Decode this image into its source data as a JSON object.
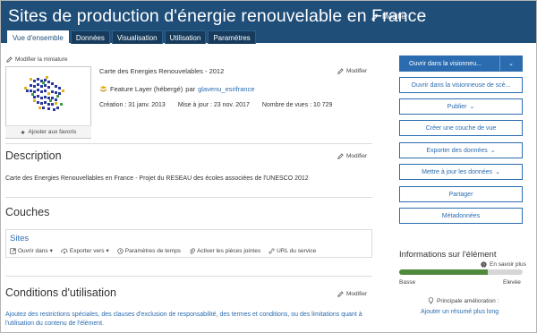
{
  "header": {
    "title": "Sites de production d'énergie renouvelable en France",
    "edit_label": "Modifier",
    "tabs": [
      {
        "label": "Vue d'ensemble"
      },
      {
        "label": "Données"
      },
      {
        "label": "Visualisation"
      },
      {
        "label": "Utilisation"
      },
      {
        "label": "Paramètres"
      }
    ]
  },
  "item": {
    "thumbnail_caption": "Modifier la miniature",
    "favorite_label": "Ajouter aux favoris",
    "name": "Carte des Energies Renouvelables - 2012",
    "edit_label": "Modifier",
    "type": "Feature Layer (hébergé)",
    "by": "par",
    "owner": "glavenu_esrifrance",
    "created": "Création : 31 janv. 2013",
    "updated": "Mise à jour : 23 nov. 2017",
    "views": "Nombre de vues : 10 729"
  },
  "description": {
    "heading": "Description",
    "edit_label": "Modifier",
    "text": "Carte des Energies Renouvellables en France - Projet du RESEAU des écoles associées de l'UNESCO 2012"
  },
  "layers": {
    "heading": "Couches",
    "layer_name": "Sites",
    "actions": [
      "Ouvrir dans",
      "Exporter vers",
      "Paramètres de temps",
      "Activer les pièces jointes",
      "URL du service"
    ]
  },
  "conditions": {
    "heading": "Conditions d'utilisation",
    "edit_label": "Modifier",
    "text": "Ajoutez des restrictions spéciales, des clauses d'exclusion de responsabilité, des termes et conditions, ou des limitations quant à l'utilisation du contenu de l'élément."
  },
  "actions": {
    "open_viewer": "Ouvrir dans la visionneu...",
    "open_scene": "Ouvrir dans la visionneuse de scè...",
    "publish": "Publier",
    "create_view": "Créer une couche de vue",
    "export": "Exporter des données",
    "update": "Mettre à jour les données",
    "share": "Partager",
    "metadata": "Métadonnées"
  },
  "info": {
    "heading": "Informations sur l'élément",
    "learn_more": "En savoir plus",
    "score_fraction": 0.72,
    "low": "Basse",
    "high": "Elevée",
    "improvement_label": "Principale amélioration :",
    "improvement_link": "Ajouter un résumé plus long"
  },
  "colors": {
    "header": "#1f4e79",
    "accent": "#2b6cb0",
    "score": "#4f8a3c"
  }
}
